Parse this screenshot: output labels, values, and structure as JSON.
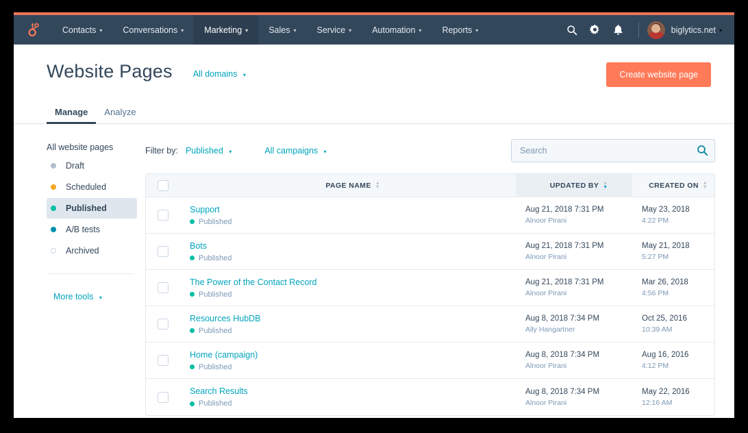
{
  "theme": {
    "nav_bg": "#33475b",
    "accent_orange": "#ff7a59",
    "strip_orange": "#f2765a",
    "teal": "#00a4bd",
    "status_green": "#00bda5"
  },
  "topnav": {
    "logo_name": "hubspot-sprocket-logo",
    "items": [
      {
        "label": "Contacts",
        "active": false
      },
      {
        "label": "Conversations",
        "active": false
      },
      {
        "label": "Marketing",
        "active": true
      },
      {
        "label": "Sales",
        "active": false
      },
      {
        "label": "Service",
        "active": false
      },
      {
        "label": "Automation",
        "active": false
      },
      {
        "label": "Reports",
        "active": false
      }
    ],
    "caret": "▾",
    "icons": [
      {
        "name": "search-icon"
      },
      {
        "name": "gear-icon"
      },
      {
        "name": "bell-icon"
      }
    ],
    "account": {
      "name": "biglytics.net",
      "avatar_name": "user-avatar",
      "caret": "▾"
    }
  },
  "header": {
    "title": "Website Pages",
    "domain_filter": "All domains",
    "caret": "▾",
    "create_button": "Create website page"
  },
  "tabs": [
    {
      "label": "Manage",
      "active": true
    },
    {
      "label": "Analyze",
      "active": false
    }
  ],
  "sidebar": {
    "all_label": "All website pages",
    "items": [
      {
        "label": "Draft",
        "dot_color": "#b0bfce",
        "hollow": false,
        "selected": false
      },
      {
        "label": "Scheduled",
        "dot_color": "#f5a623",
        "hollow": false,
        "selected": false
      },
      {
        "label": "Published",
        "dot_color": "#00bda5",
        "hollow": false,
        "selected": true
      },
      {
        "label": "A/B tests",
        "dot_color": "#0091ae",
        "hollow": false,
        "selected": false
      },
      {
        "label": "Archived",
        "dot_color": "#cbd6e2",
        "hollow": true,
        "selected": false
      }
    ],
    "more_tools": "More tools",
    "more_tools_caret": "▾"
  },
  "filters": {
    "label": "Filter by:",
    "status": "Published",
    "campaign": "All campaigns",
    "caret": "▾"
  },
  "search": {
    "placeholder": "Search",
    "value": "",
    "icon_name": "search-icon"
  },
  "table": {
    "columns": [
      {
        "key": "name",
        "label": "PAGE NAME",
        "sorted": false,
        "sort_dir": ""
      },
      {
        "key": "updated",
        "label": "UPDATED BY",
        "sorted": true,
        "sort_dir": "desc"
      },
      {
        "key": "created",
        "label": "CREATED ON",
        "sorted": false,
        "sort_dir": ""
      }
    ],
    "rows": [
      {
        "name": "Support",
        "status": "Published",
        "updated_date": "Aug 21, 2018 7:31 PM",
        "updated_by": "Alnoor Pirani",
        "created_date": "May 23, 2018",
        "created_time": "4:22 PM",
        "checked": false
      },
      {
        "name": "Bots",
        "status": "Published",
        "updated_date": "Aug 21, 2018 7:31 PM",
        "updated_by": "Alnoor Pirani",
        "created_date": "May 21, 2018",
        "created_time": "5:27 PM",
        "checked": false
      },
      {
        "name": "The Power of the Contact Record",
        "status": "Published",
        "updated_date": "Aug 21, 2018 7:31 PM",
        "updated_by": "Alnoor Pirani",
        "created_date": "Mar 26, 2018",
        "created_time": "4:56 PM",
        "checked": false
      },
      {
        "name": "Resources HubDB",
        "status": "Published",
        "updated_date": "Aug 8, 2018 7:34 PM",
        "updated_by": "Ally Hangartner",
        "created_date": "Oct 25, 2016",
        "created_time": "10:39 AM",
        "checked": false
      },
      {
        "name": "Home (campaign)",
        "status": "Published",
        "updated_date": "Aug 8, 2018 7:34 PM",
        "updated_by": "Alnoor Pirani",
        "created_date": "Aug 16, 2016",
        "created_time": "4:12 PM",
        "checked": false
      },
      {
        "name": "Search Results",
        "status": "Published",
        "updated_date": "Aug 8, 2018 7:34 PM",
        "updated_by": "Alnoor Pirani",
        "created_date": "May 22, 2016",
        "created_time": "12:16 AM",
        "checked": false
      }
    ]
  }
}
